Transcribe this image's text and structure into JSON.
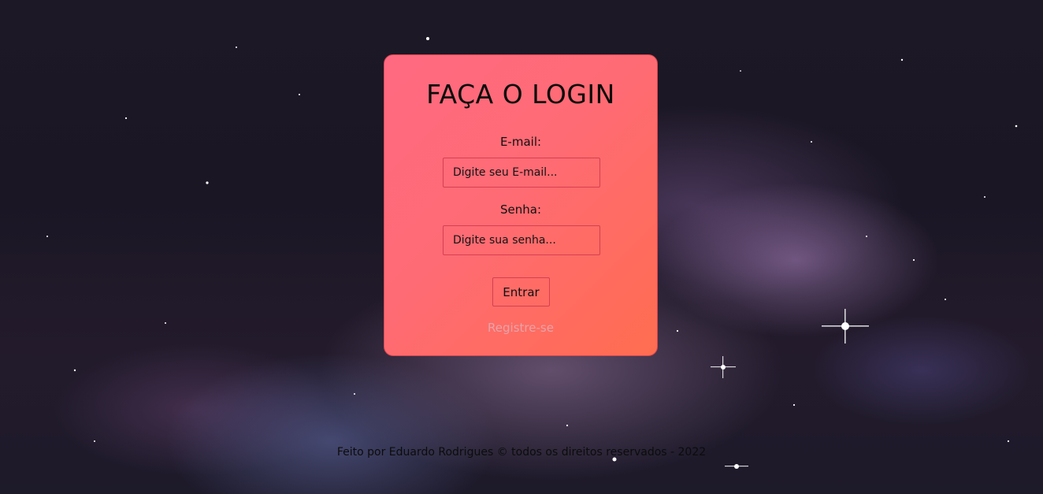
{
  "login": {
    "title": "FAÇA O LOGIN",
    "email_label": "E-mail:",
    "email_placeholder": "Digite seu E-mail...",
    "password_label": "Senha:",
    "password_placeholder": "Digite sua senha...",
    "submit_label": "Entrar",
    "register_label": "Registre-se"
  },
  "footer": {
    "text": "Feito por Eduardo Rodrigues © todos os direitos reservados - 2022"
  },
  "colors": {
    "card_gradient_start": "#ff6a82",
    "card_gradient_end": "#ff6d50",
    "card_border": "#d8454f",
    "register_link": "#e6a3aa"
  }
}
